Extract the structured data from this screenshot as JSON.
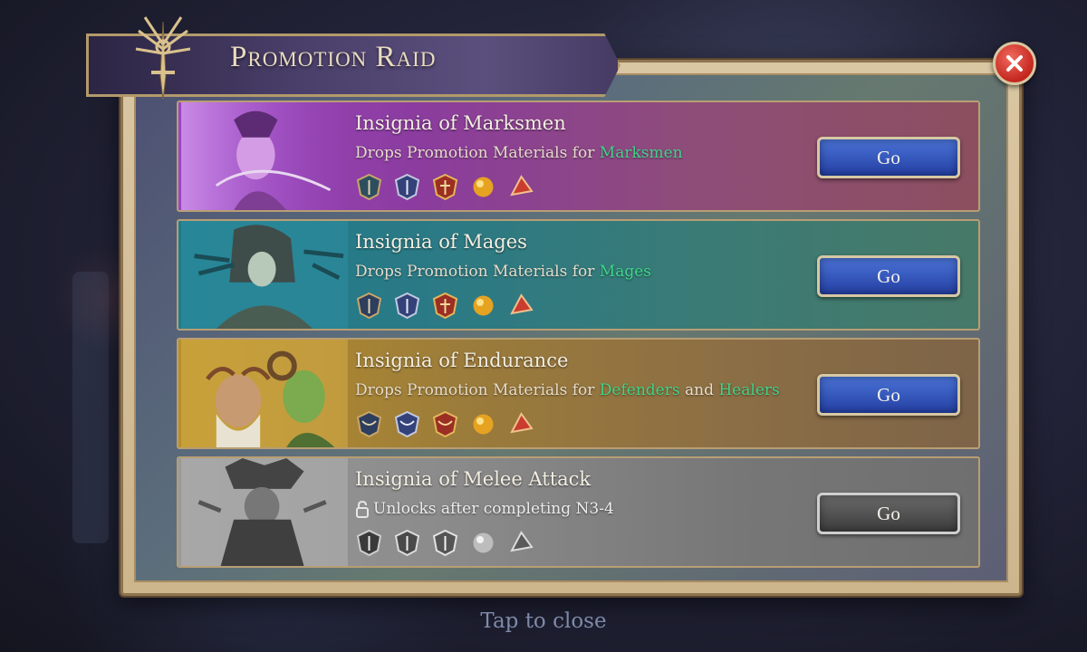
{
  "header": {
    "title": "Promotion Raid"
  },
  "raids": [
    {
      "title": "Insignia of Marksmen",
      "desc_prefix": "Drops Promotion Materials for ",
      "class_name": "Marksmen",
      "go_label": "Go",
      "theme": {
        "from": "#8a3fb0",
        "to": "#a2566a"
      }
    },
    {
      "title": "Insignia of Mages",
      "desc_prefix": "Drops Promotion Materials for ",
      "class_name": "Mages",
      "go_label": "Go",
      "theme": {
        "from": "#237a86",
        "to": "#3d7a72"
      }
    },
    {
      "title": "Insignia of Endurance",
      "desc_prefix": "Drops Promotion Materials for ",
      "class_name": "Defenders",
      "joiner": " and ",
      "class_name_2": "Healers",
      "go_label": "Go",
      "theme": {
        "from": "#b08a25",
        "to": "#8b6a3a"
      }
    },
    {
      "title": "Insignia of Melee Attack",
      "locked_text": "Unlocks after completing N3-4",
      "go_label": "Go",
      "theme": {
        "from": "#8d8d8d",
        "to": "#6e6e6e"
      }
    }
  ],
  "footer": {
    "tap_to_close": "Tap to close"
  },
  "colors": {
    "highlight": "#3fd489",
    "go_button": "#3558c4",
    "close_button": "#d9362b"
  }
}
